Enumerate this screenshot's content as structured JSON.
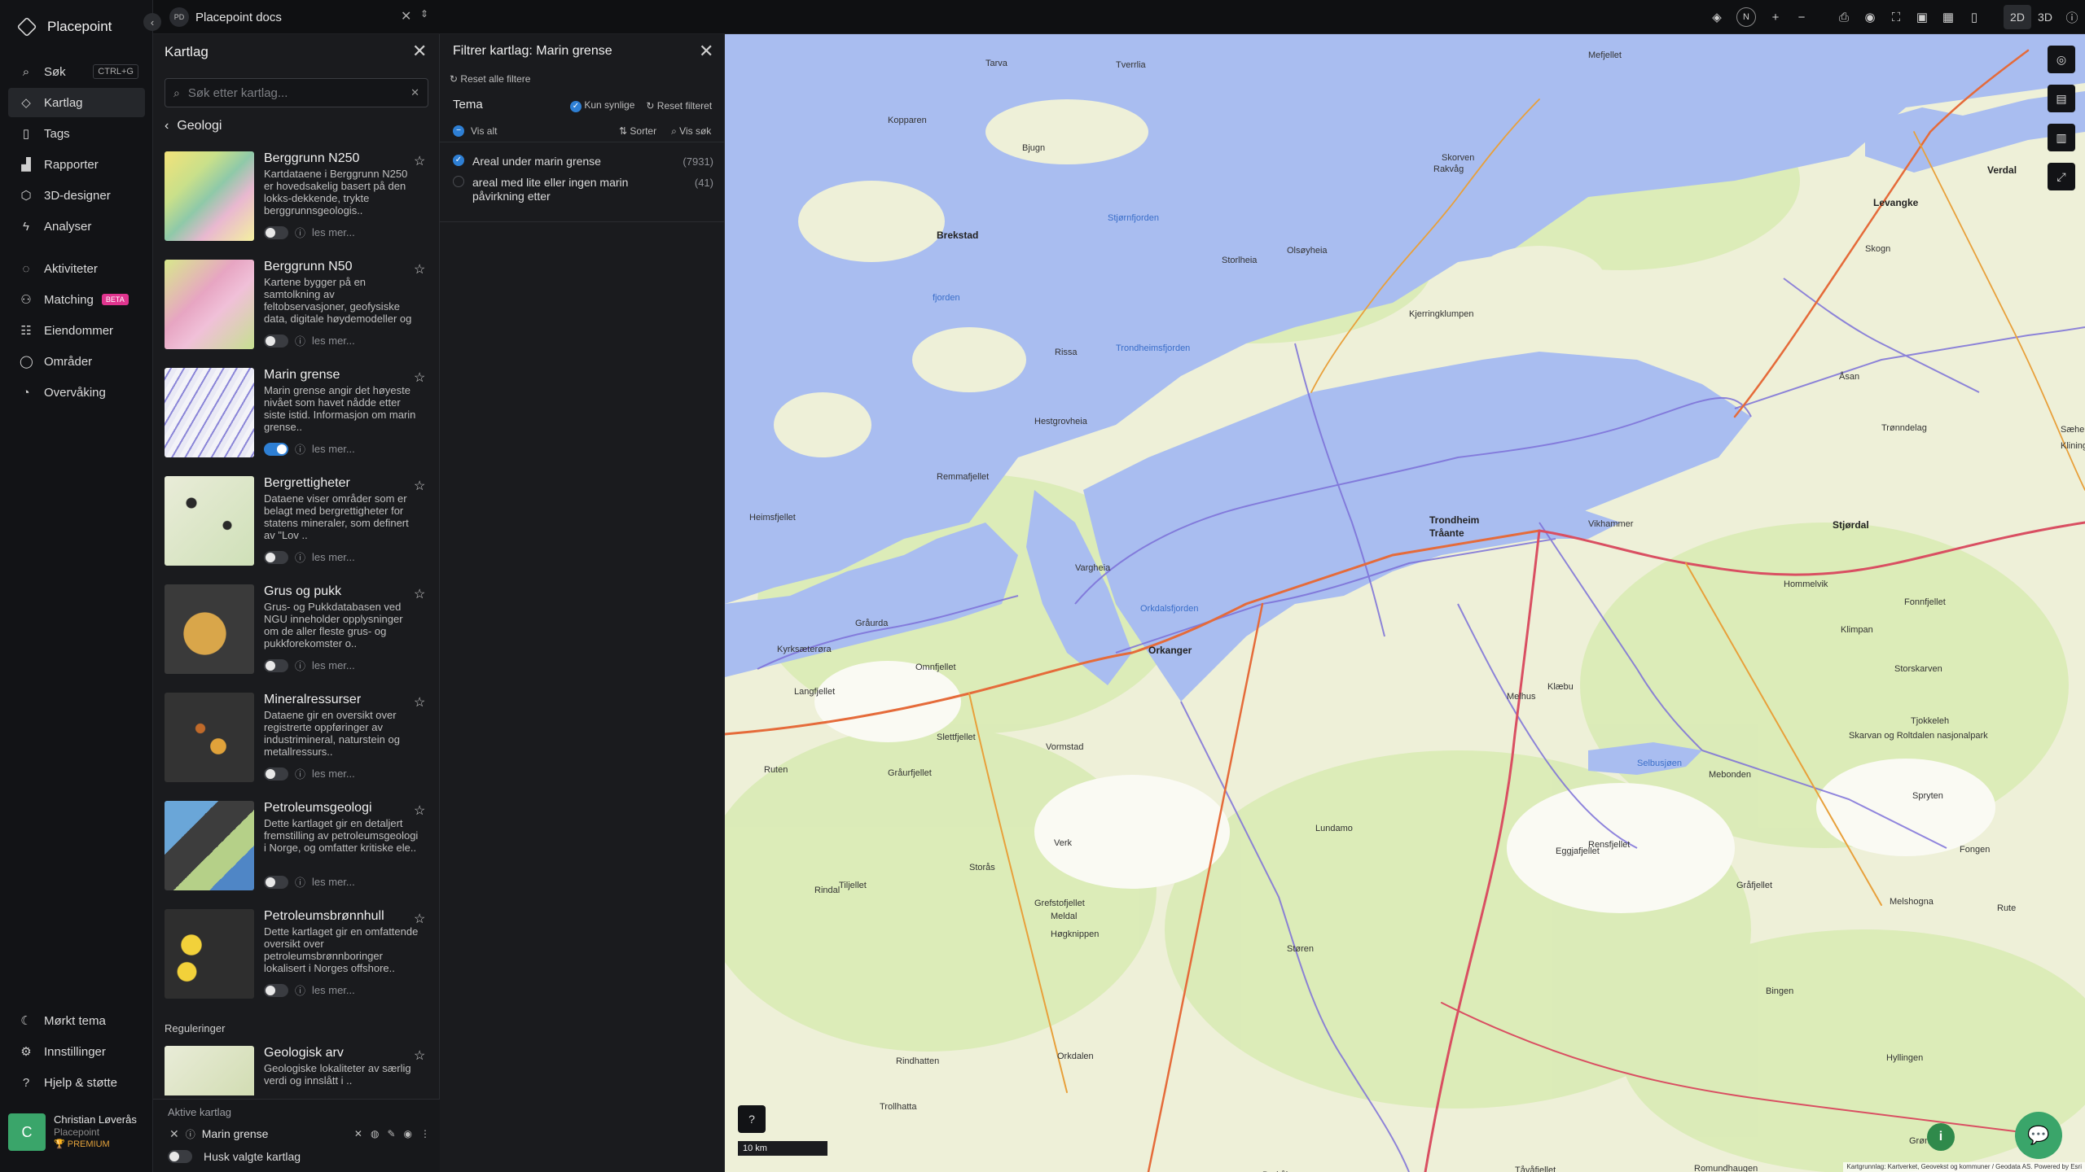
{
  "app": {
    "name": "Placepoint"
  },
  "sidebar": {
    "items": [
      {
        "label": "Søk",
        "icon": "search-icon",
        "shortcut": "CTRL+G"
      },
      {
        "label": "Kartlag",
        "icon": "layers-icon",
        "active": true
      },
      {
        "label": "Tags",
        "icon": "bookmark-icon"
      },
      {
        "label": "Rapporter",
        "icon": "chart-icon"
      },
      {
        "label": "3D-designer",
        "icon": "cube-icon"
      },
      {
        "label": "Analyser",
        "icon": "bolt-icon"
      }
    ],
    "items2": [
      {
        "label": "Aktiviteter",
        "icon": "activity-icon"
      },
      {
        "label": "Matching",
        "icon": "matching-icon",
        "badge": "BETA"
      },
      {
        "label": "Eiendommer",
        "icon": "property-icon"
      },
      {
        "label": "Områder",
        "icon": "area-icon"
      },
      {
        "label": "Overvåking",
        "icon": "monitor-icon"
      }
    ],
    "bottom": [
      {
        "label": "Mørkt tema",
        "icon": "moon-icon"
      },
      {
        "label": "Innstillinger",
        "icon": "gear-icon"
      },
      {
        "label": "Hjelp & støtte",
        "icon": "help-icon"
      }
    ],
    "user": {
      "initial": "C",
      "name": "Christian Løverås",
      "org": "Placepoint",
      "plan": "PREMIUM"
    }
  },
  "topbar": {
    "doc_badge": "PD",
    "doc_title": "Placepoint docs",
    "mode_2d": "2D",
    "mode_3d": "3D",
    "compass": "N"
  },
  "layers": {
    "title": "Kartlag",
    "search_placeholder": "Søk etter kartlag...",
    "back_label": "Geologi",
    "more_label": "les mer...",
    "items": [
      {
        "title": "Berggrunn N250",
        "desc": "Kartdataene i Berggrunn N250 er hovedsakelig basert på den lokks-dekkende, trykte berggrunnsgeologis..",
        "on": false
      },
      {
        "title": "Berggrunn N50",
        "desc": "Kartene bygger på en samtolkning av feltobservasjoner, geofysiske data, digitale høydemodeller og fl..",
        "on": false
      },
      {
        "title": "Marin grense",
        "desc": "Marin grense angir det høyeste nivået som havet nådde etter siste istid. Informasjon om marin grense..",
        "on": true
      },
      {
        "title": "Bergrettigheter",
        "desc": "Dataene viser områder som er belagt med bergrettigheter for statens mineraler, som definert av \"Lov ..",
        "on": false
      },
      {
        "title": "Grus og pukk",
        "desc": "Grus- og Pukkdatabasen ved NGU inneholder opplysninger om de aller fleste grus- og pukkforekomster o..",
        "on": false
      },
      {
        "title": "Mineralressurser",
        "desc": "Dataene gir en oversikt over registrerte oppføringer av industrimineral, naturstein og metallressurs..",
        "on": false
      },
      {
        "title": "Petroleumsgeologi",
        "desc": "Dette kartlaget gir en detaljert fremstilling av petroleumsgeologi i Norge, og omfatter kritiske ele..",
        "on": false
      },
      {
        "title": "Petroleumsbrønnhull",
        "desc": "Dette kartlaget gir en omfattende oversikt over petroleumsbrønnboringer lokalisert i Norges offshore..",
        "on": false
      }
    ],
    "section2": "Reguleringer",
    "items_reg": [
      {
        "title": "Geologisk arv",
        "desc": "Geologiske lokaliteter av særlig verdi og innslått i .."
      }
    ],
    "active_title": "Aktive kartlag",
    "active_layer": "Marin grense",
    "keep_label": "Husk valgte kartlag"
  },
  "filter": {
    "title": "Filtrer kartlag: Marin grense",
    "reset_all": "Reset alle filtere",
    "tema": "Tema",
    "only_visible": "Kun synlige",
    "reset_filter": "Reset filteret",
    "show_all": "Vis alt",
    "sort": "Sorter",
    "search": "Vis søk",
    "rows": [
      {
        "label": "Areal under marin grense",
        "count": "(7931)",
        "checked": true
      },
      {
        "label": "areal med lite eller ingen marin påvirkning etter",
        "count": "(41)",
        "checked": false
      }
    ]
  },
  "map": {
    "labels": [
      {
        "t": "Trondheim",
        "big": true
      },
      {
        "t": "Tråante",
        "big": true
      },
      {
        "t": "Stjørdal",
        "big": true
      },
      {
        "t": "Orkanger",
        "big": true
      },
      {
        "t": "Levangke",
        "big": true
      },
      {
        "t": "Verdal",
        "big": true
      },
      {
        "t": "Brekstad",
        "big": true
      },
      {
        "t": "Trondheimsfjorden",
        "water": true
      },
      {
        "t": "Stjørnfjorden",
        "water": true
      },
      {
        "t": "Orkdalsfjorden",
        "water": true
      },
      {
        "t": "Selbusjøen",
        "water": true
      },
      {
        "t": "fjorden",
        "water": true
      },
      {
        "t": "Melhus"
      },
      {
        "t": "Klæbu"
      },
      {
        "t": "Støren"
      },
      {
        "t": "Meldal"
      },
      {
        "t": "Lundamo"
      },
      {
        "t": "Vikhammer"
      },
      {
        "t": "Hommelvik"
      },
      {
        "t": "Mebonden"
      },
      {
        "t": "Rissa"
      },
      {
        "t": "Bjugn"
      },
      {
        "t": "Verk"
      },
      {
        "t": "Storås"
      },
      {
        "t": "Rindal"
      },
      {
        "t": "Vormstad"
      },
      {
        "t": "Skogn"
      },
      {
        "t": "Åsan"
      },
      {
        "t": "Kopparen"
      },
      {
        "t": "Hestgrovheia"
      },
      {
        "t": "Remmafjellet"
      },
      {
        "t": "Heimsfjellet"
      },
      {
        "t": "Langfjellet"
      },
      {
        "t": "Slettfjellet"
      },
      {
        "t": "Gråurfjellet"
      },
      {
        "t": "Ruten"
      },
      {
        "t": "Tiljellet"
      },
      {
        "t": "Grefstofjellet"
      },
      {
        "t": "Høgknippen"
      },
      {
        "t": "Eggjafjellet"
      },
      {
        "t": "Rensfjellet"
      },
      {
        "t": "Gråfjellet"
      },
      {
        "t": "Skarvan og Roltdalen nasjonalpark"
      },
      {
        "t": "Trønndelag"
      },
      {
        "t": "Fonnfjellet"
      },
      {
        "t": "Klimpan"
      },
      {
        "t": "Storskarven"
      },
      {
        "t": "Fongen"
      },
      {
        "t": "Melshogna"
      },
      {
        "t": "Bingen"
      },
      {
        "t": "Hyllingen"
      },
      {
        "t": "Grønfjellet"
      },
      {
        "t": "Romundhaugen"
      },
      {
        "t": "Tåvåfjellet"
      },
      {
        "t": "Berkåk"
      },
      {
        "t": "Orkdalen"
      },
      {
        "t": "Rindhatten"
      },
      {
        "t": "Trollhatta"
      },
      {
        "t": "Vargheia"
      },
      {
        "t": "Omnfjellet"
      },
      {
        "t": "Gråurda"
      },
      {
        "t": "Kyrksæterøra"
      },
      {
        "t": "Storlheia"
      },
      {
        "t": "Olsøyheia"
      },
      {
        "t": "Skorven"
      },
      {
        "t": "Kjerringklumpen"
      },
      {
        "t": "Mefjellet"
      },
      {
        "t": "Tverrlia"
      },
      {
        "t": "Tarva"
      },
      {
        "t": "Rakvåg"
      },
      {
        "t": "Tjokkeleh"
      },
      {
        "t": "Spryten"
      },
      {
        "t": "Rute"
      },
      {
        "t": "Sæheia"
      },
      {
        "t": "Klininge"
      }
    ],
    "scale": "10 km",
    "attribution": "Kartgrunnlag: Kartverket, Geovekst og kommuner / Geodata AS. Powered by Esri"
  }
}
